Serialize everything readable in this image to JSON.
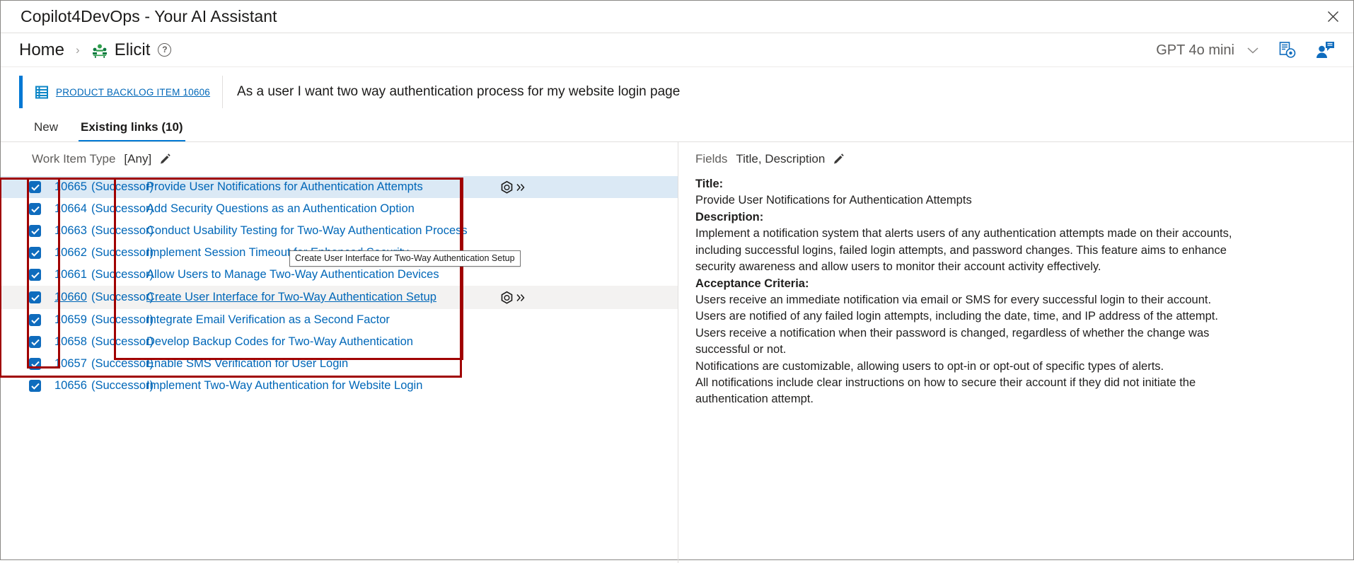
{
  "window": {
    "title": "Copilot4DevOps - Your AI Assistant",
    "close_label": "close-icon"
  },
  "breadcrumb": {
    "home": "Home",
    "separator": "›",
    "current": "Elicit",
    "help": "?"
  },
  "header": {
    "model": "GPT 4o mini",
    "chevron": "chevron-down-icon",
    "doc_settings_icon": "document-settings-icon",
    "user_chat_icon": "user-chat-icon"
  },
  "work_item": {
    "type_icon": "backlog-item-icon",
    "link": "PRODUCT BACKLOG ITEM 10606",
    "title": "As a user I want two way authentication process for my website login page"
  },
  "tabs": [
    {
      "label": "New",
      "active": false
    },
    {
      "label": "Existing links (10)",
      "active": true
    }
  ],
  "filter": {
    "label": "Work Item Type",
    "value": "[Any]",
    "edit_icon": "pencil-icon"
  },
  "fields": {
    "label": "Fields",
    "value": "Title, Description",
    "edit_icon": "pencil-icon"
  },
  "links": [
    {
      "id": "10665",
      "relation": "(Successor)",
      "title": "Provide User Notifications for Authentication Attempts",
      "checked": true,
      "selected": true,
      "hover": false,
      "underline": false,
      "icon": true
    },
    {
      "id": "10664",
      "relation": "(Successor)",
      "title": "Add Security Questions as an Authentication Option",
      "checked": true,
      "selected": false,
      "hover": false,
      "underline": false,
      "icon": false
    },
    {
      "id": "10663",
      "relation": "(Successor)",
      "title": "Conduct Usability Testing for Two-Way Authentication Process",
      "checked": true,
      "selected": false,
      "hover": false,
      "underline": false,
      "icon": false
    },
    {
      "id": "10662",
      "relation": "(Successor)",
      "title": "Implement Session Timeout for Enhanced Security",
      "checked": true,
      "selected": false,
      "hover": false,
      "underline": false,
      "icon": false
    },
    {
      "id": "10661",
      "relation": "(Successor)",
      "title": "Allow Users to Manage Two-Way Authentication Devices",
      "checked": true,
      "selected": false,
      "hover": false,
      "underline": false,
      "icon": false
    },
    {
      "id": "10660",
      "relation": "(Successor)",
      "title": "Create User Interface for Two-Way Authentication Setup",
      "checked": true,
      "selected": false,
      "hover": true,
      "underline": true,
      "icon": true
    },
    {
      "id": "10659",
      "relation": "(Successor)",
      "title": "Integrate Email Verification as a Second Factor",
      "checked": true,
      "selected": false,
      "hover": false,
      "underline": false,
      "icon": false
    },
    {
      "id": "10658",
      "relation": "(Successor)",
      "title": "Develop Backup Codes for Two-Way Authentication",
      "checked": true,
      "selected": false,
      "hover": false,
      "underline": false,
      "icon": false
    },
    {
      "id": "10657",
      "relation": "(Successor)",
      "title": "Enable SMS Verification for User Login",
      "checked": true,
      "selected": false,
      "hover": false,
      "underline": false,
      "icon": false
    },
    {
      "id": "10656",
      "relation": "(Successor)",
      "title": "Implement Two-Way Authentication for Website Login",
      "checked": true,
      "selected": false,
      "hover": false,
      "underline": false,
      "icon": false
    }
  ],
  "tooltip": {
    "text": "Create User Interface for Two-Way Authentication Setup"
  },
  "detail": {
    "title_label": "Title:",
    "title_value": "Provide User Notifications for Authentication Attempts",
    "description_label": "Description:",
    "description_value": "Implement a notification system that alerts users of any authentication attempts made on their accounts, including successful logins, failed login attempts, and password changes. This feature aims to enhance security awareness and allow users to monitor their account activity effectively.",
    "acceptance_label": "Acceptance Criteria:",
    "acceptance_criteria": [
      "Users receive an immediate notification via email or SMS for every successful login to their account.",
      "Users are notified of any failed login attempts, including the date, time, and IP address of the attempt.",
      "Users receive a notification when their password is changed, regardless of whether the change was successful or not.",
      "Notifications are customizable, allowing users to opt-in or opt-out of specific types of alerts.",
      "All notifications include clear instructions on how to secure their account if they did not initiate the authentication attempt."
    ]
  },
  "colors": {
    "accent": "#0078d4",
    "link": "#0067b8",
    "checkbox": "#0f6cbd",
    "annotation": "#a00000",
    "selected_row": "#dbe9f5"
  }
}
